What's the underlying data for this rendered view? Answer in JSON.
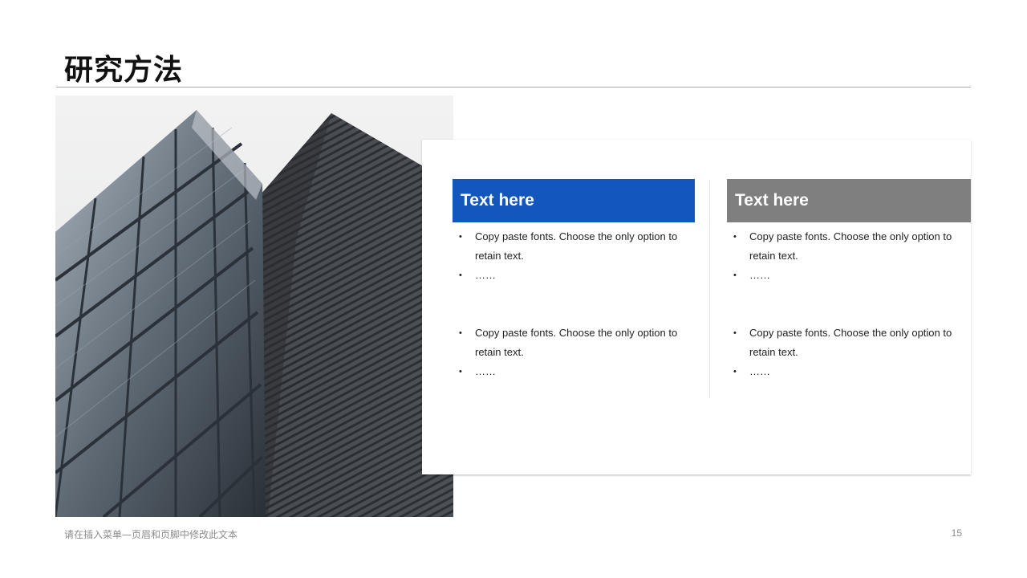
{
  "slide": {
    "title": "研究方法",
    "footer_text": "请在插入菜单—页眉和页脚中修改此文本",
    "page_number": "15",
    "image_subject": "building-facade-photo",
    "colors": {
      "accent_blue": "#1356bd",
      "accent_gray": "#7f7f7f",
      "rule": "#a6a6a6"
    }
  },
  "columns": [
    {
      "heading": "Text here",
      "groups": [
        {
          "items": [
            "Copy paste fonts. Choose the only option to retain text.",
            "……"
          ]
        },
        {
          "items": [
            "Copy paste fonts. Choose the only option to retain text.",
            "……"
          ]
        }
      ]
    },
    {
      "heading": "Text here",
      "groups": [
        {
          "items": [
            "Copy paste fonts. Choose the only option to retain text.",
            "……"
          ]
        },
        {
          "items": [
            "Copy paste fonts. Choose the only option to retain text.",
            "……"
          ]
        }
      ]
    }
  ]
}
